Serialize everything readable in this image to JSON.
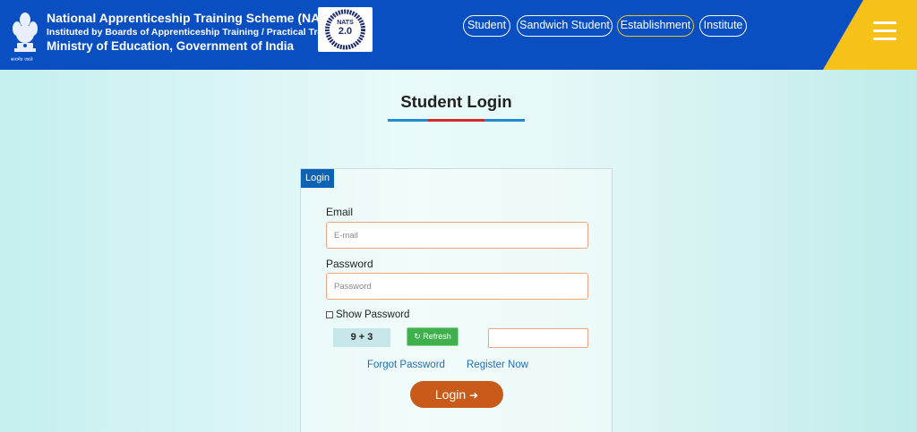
{
  "header": {
    "emblem_caption": "सत्यमेव जयते",
    "title_main": "National Apprenticeship Training Scheme (NATS)",
    "title_sub": "Instituted by Boards of Apprenticeship Training / Practical Training",
    "title_ministry": "Ministry of Education, Government of India",
    "logo_text": "NATS",
    "logo_version": "2.0",
    "nav": [
      "Student",
      "Sandwich Student",
      "Establishment",
      "Institute"
    ],
    "accent_blue": "#0a4fc2",
    "accent_yellow": "#f6c21a"
  },
  "page": {
    "title": "Student Login"
  },
  "login": {
    "tab_label": "Login",
    "email_label": "Email",
    "email_placeholder": "E-mail",
    "password_label": "Password",
    "password_placeholder": "Password",
    "show_password_label": "Show Password",
    "captcha_text": "9 + 3",
    "refresh_label": "Refresh",
    "forgot_password": "Forgot Password",
    "register_now": "Register Now",
    "login_button": "Login"
  }
}
